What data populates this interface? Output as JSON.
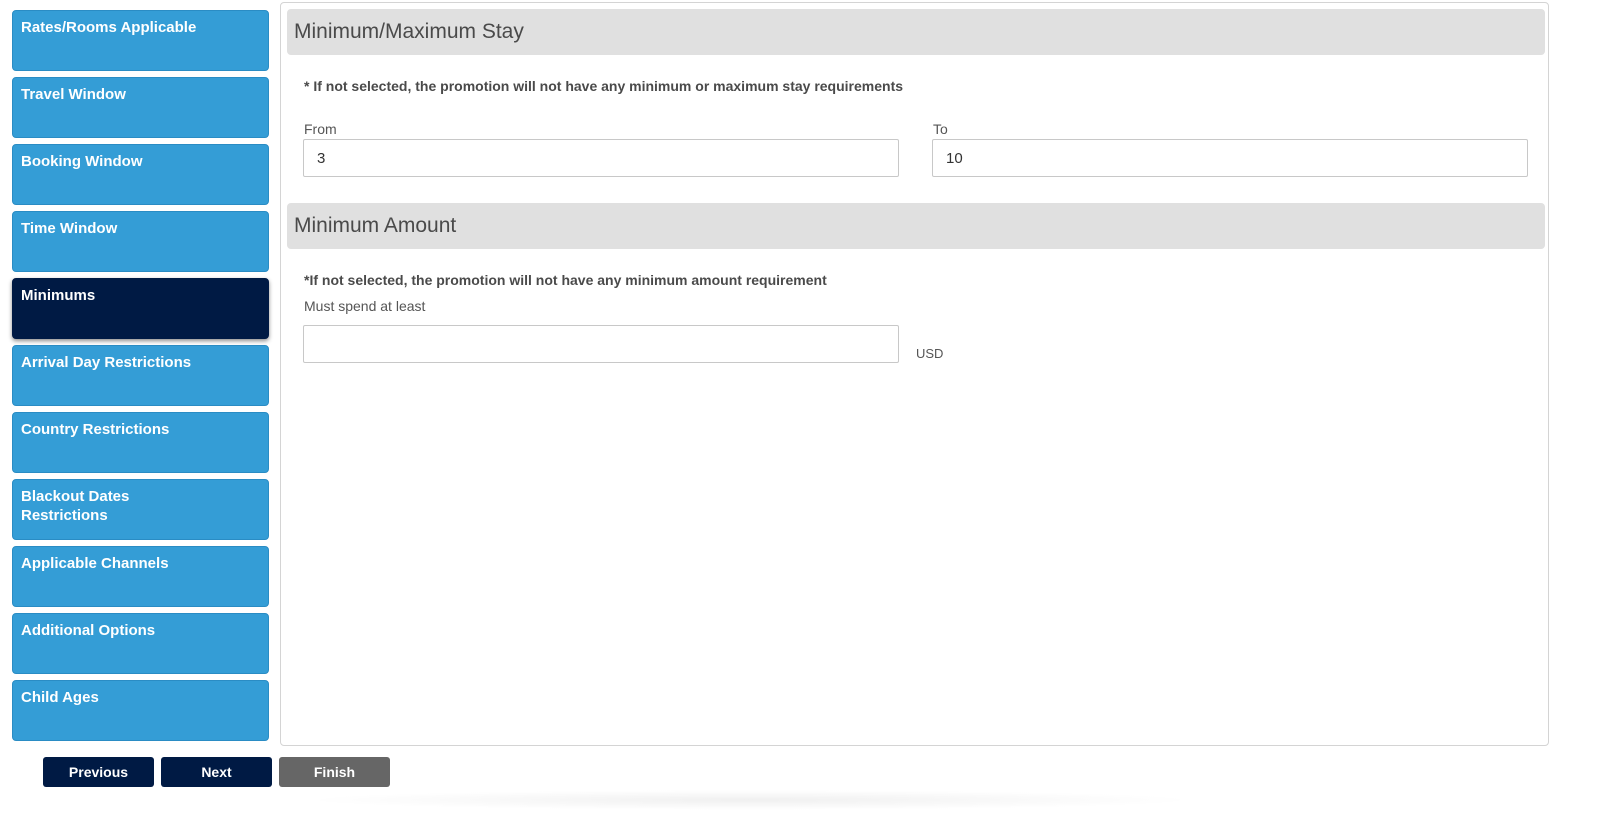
{
  "sidebar": {
    "items": [
      {
        "label": "Rates/Rooms Applicable"
      },
      {
        "label": "Travel Window"
      },
      {
        "label": "Booking Window"
      },
      {
        "label": "Time Window"
      },
      {
        "label": "Minimums"
      },
      {
        "label": "Arrival Day Restrictions"
      },
      {
        "label": "Country Restrictions"
      },
      {
        "label": "Blackout Dates Restrictions"
      },
      {
        "label": "Applicable Channels"
      },
      {
        "label": "Additional Options"
      },
      {
        "label": "Child Ages"
      }
    ],
    "active": "Minimums"
  },
  "stay": {
    "title": "Minimum/Maximum Stay",
    "note": "* If not selected, the promotion will not have any minimum or maximum stay requirements",
    "from_label": "From",
    "from_value": "3",
    "to_label": "To",
    "to_value": "10"
  },
  "amount": {
    "title": "Minimum Amount",
    "note": "*If not selected, the promotion will not have any minimum amount requirement",
    "spend_label": "Must spend at least",
    "spend_value": "",
    "currency": "USD"
  },
  "footer": {
    "previous_label": "Previous",
    "next_label": "Next",
    "finish_label": "Finish"
  },
  "colors": {
    "sidebar_item": "#349dd6",
    "sidebar_active": "#001a44",
    "button_dark": "#001a44",
    "button_disabled": "#666666",
    "section_header": "#e0e0e0"
  }
}
